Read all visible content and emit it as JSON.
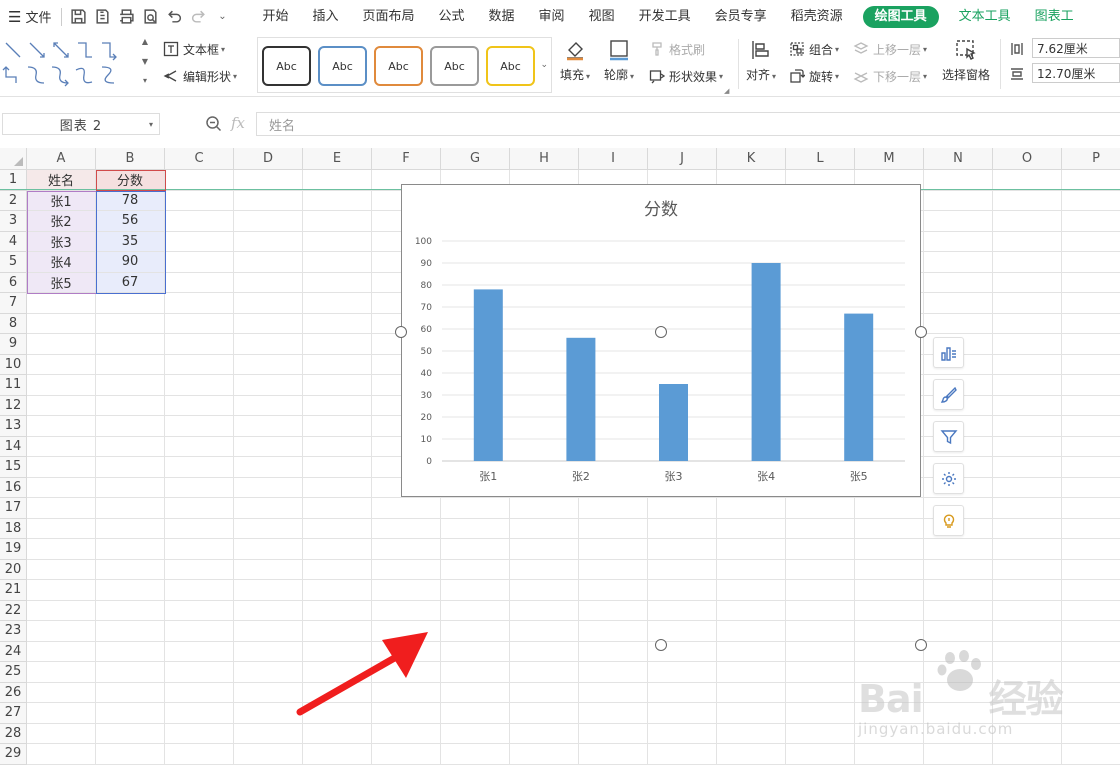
{
  "menubar": {
    "file_label": "文件",
    "tabs": [
      "开始",
      "插入",
      "页面布局",
      "公式",
      "数据",
      "审阅",
      "视图",
      "开发工具",
      "会员专享",
      "稻壳资源"
    ],
    "active_tab": "绘图工具",
    "extra_tabs": [
      "文本工具",
      "图表工"
    ]
  },
  "ribbon": {
    "textbox_label": "文本框",
    "edit_shape_label": "编辑形状",
    "style_samples": [
      "Abc",
      "Abc",
      "Abc",
      "Abc",
      "Abc"
    ],
    "style_colors": [
      "#333333",
      "#5b8fc6",
      "#e08a3c",
      "#9a9a9a",
      "#f0c419"
    ],
    "fill_label": "填充",
    "outline_label": "轮廓",
    "format_painter_label": "格式刷",
    "shape_effects_label": "形状效果",
    "align_label": "对齐",
    "group_label": "组合",
    "rotate_label": "旋转",
    "bring_forward_label": "上移一层",
    "send_backward_label": "下移一层",
    "selection_pane_label": "选择窗格",
    "height_value": "7.62厘米",
    "width_value": "12.70厘米"
  },
  "formula_bar": {
    "name_box": "图表 2",
    "fx_label": "fx",
    "formula": "姓名"
  },
  "sheet": {
    "columns": [
      "A",
      "B",
      "C",
      "D",
      "E",
      "F",
      "G",
      "H",
      "I",
      "J",
      "K",
      "L",
      "M",
      "N",
      "O",
      "P"
    ],
    "rows": [
      "1",
      "2",
      "3",
      "4",
      "5",
      "6",
      "7",
      "8",
      "9",
      "10",
      "11",
      "12",
      "13",
      "14",
      "15",
      "16",
      "17",
      "18",
      "19",
      "20",
      "21",
      "22",
      "23",
      "24",
      "25",
      "26",
      "27",
      "28",
      "29"
    ],
    "headers": [
      "姓名",
      "分数"
    ],
    "data": [
      [
        "张1",
        "78"
      ],
      [
        "张2",
        "56"
      ],
      [
        "张3",
        "35"
      ],
      [
        "张4",
        "90"
      ],
      [
        "张5",
        "67"
      ]
    ]
  },
  "chart_data": {
    "type": "bar",
    "title": "分数",
    "categories": [
      "张1",
      "张2",
      "张3",
      "张4",
      "张5"
    ],
    "values": [
      78,
      56,
      35,
      90,
      67
    ],
    "ylim": [
      0,
      100
    ],
    "yticks": [
      "0",
      "10",
      "20",
      "30",
      "40",
      "50",
      "60",
      "70",
      "80",
      "90",
      "100"
    ],
    "grid": true,
    "bar_color": "#5b9bd5"
  },
  "chart_tools": [
    "chart-elements-icon",
    "brush-icon",
    "filter-icon",
    "gear-icon",
    "lightbulb-icon"
  ],
  "watermark": {
    "brand": "Bai",
    "brand_suffix": "经验",
    "url": "jingyan.baidu.com"
  }
}
